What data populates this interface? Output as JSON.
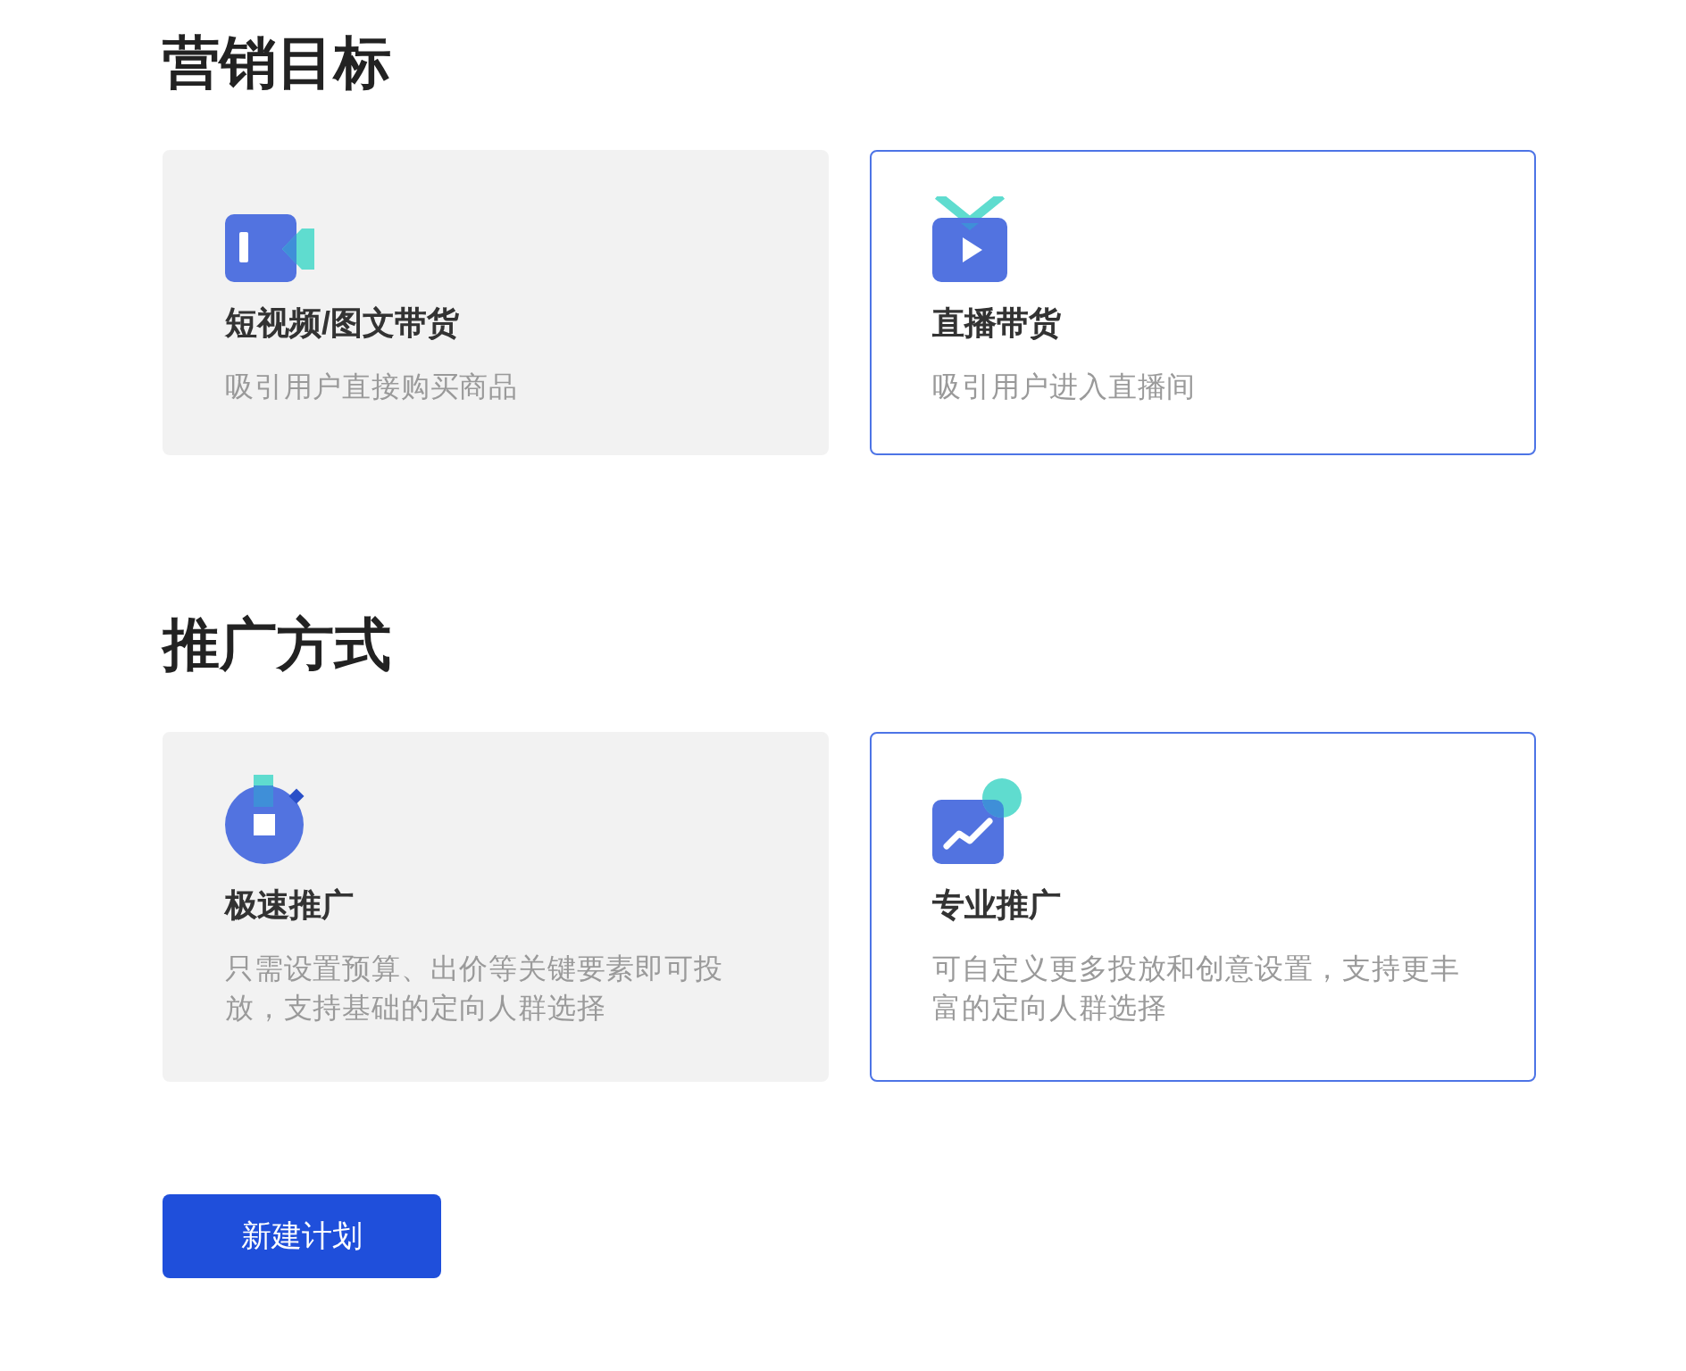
{
  "sections": [
    {
      "title": "营销目标",
      "options": [
        {
          "kind": "video",
          "title": "短视频/图文带货",
          "description": "吸引用户直接购买商品",
          "selected": false
        },
        {
          "kind": "live",
          "title": "直播带货",
          "description": "吸引用户进入直播间",
          "selected": true
        }
      ]
    },
    {
      "title": "推广方式",
      "options": [
        {
          "kind": "stopwatch",
          "title": "极速推广",
          "description": "只需设置预算、出价等关键要素即可投放，支持基础的定向人群选择",
          "selected": false
        },
        {
          "kind": "chart",
          "title": "专业推广",
          "description": "可自定义更多投放和创意设置，支持更丰富的定向人群选择",
          "selected": true
        }
      ]
    }
  ],
  "button": {
    "label": "新建计划"
  }
}
